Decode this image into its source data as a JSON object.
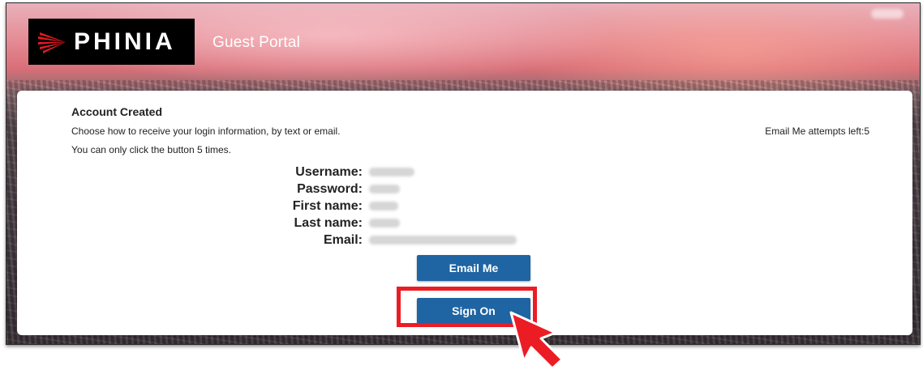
{
  "header": {
    "logo_text": "PHINIA",
    "portal_title": "Guest Portal",
    "brand_color": "#000000",
    "logo_mark_color": "#e31b23"
  },
  "card": {
    "heading": "Account Created",
    "instruction": "Choose how to receive your login information, by text or email.",
    "limit_note": "You can only click the button 5 times.",
    "attempts_left": "Email Me attempts left:5",
    "fields": [
      {
        "label": "Username:"
      },
      {
        "label": "Password:"
      },
      {
        "label": "First name:"
      },
      {
        "label": "Last name:"
      },
      {
        "label": "Email:"
      }
    ]
  },
  "buttons": {
    "email_me": "Email Me",
    "sign_on": "Sign On",
    "color": "#1f64a3"
  },
  "annotation": {
    "highlight_color": "#ec1c24",
    "cursor_icon": "hand-pointer-arrow-icon"
  }
}
